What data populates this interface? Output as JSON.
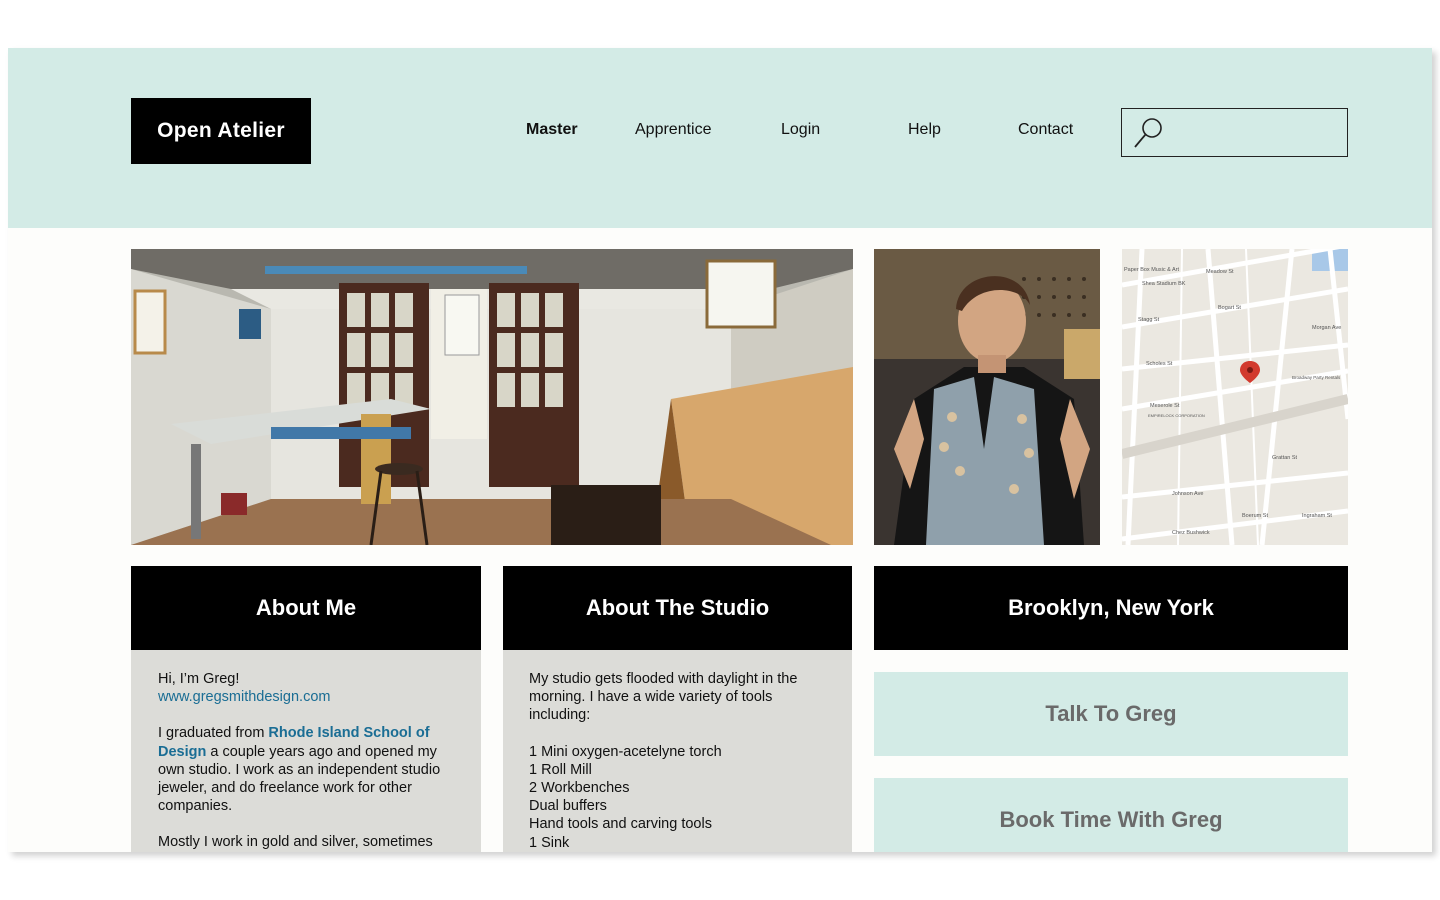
{
  "header": {
    "logo": "Open Atelier",
    "nav": [
      {
        "label": "Master",
        "active": true
      },
      {
        "label": "Apprentice",
        "active": false
      },
      {
        "label": "Login",
        "active": false
      },
      {
        "label": "Help",
        "active": false
      },
      {
        "label": "Contact",
        "active": false
      }
    ],
    "search": {
      "icon": "search-icon",
      "placeholder": ""
    }
  },
  "images": {
    "studio": "studio-interior-photo",
    "greg": "greg-portrait-photo",
    "map": "brooklyn-street-map"
  },
  "map_labels": {
    "l1": "Paper Box Music & Art",
    "l2": "Shea Stadium BK",
    "l3": "Meadow St",
    "l4": "Stagg St",
    "l5": "Scholes St",
    "l6": "Meserole St",
    "l7": "EMPIRELOCK CORPORATION",
    "l8": "Broadway Party Rentals",
    "l9": "Johnson Ave",
    "l10": "Ingraham St",
    "l11": "Bogart St",
    "l12": "Morgan Ave",
    "l13": "Grattan St",
    "l14": "Chez Bushwick",
    "l15": "Boerum St"
  },
  "about_me": {
    "title": "About Me",
    "greeting": "Hi, I’m Greg!",
    "website": "www.gregsmithdesign.com",
    "p2_a": "I graduated from ",
    "school": "Rhode Island School of Design",
    "p2_b": " a couple years ago and opened my own studio. I work as an independent studio jeweler, and do freelance work for other companies.",
    "p3": "Mostly I work in gold and silver, sometimes"
  },
  "about_studio": {
    "title": "About The Studio",
    "intro": "My studio gets flooded with daylight in the morning. I have a wide variety of tools including:",
    "tools": [
      "1 Mini oxygen-acetelyne torch",
      "1 Roll Mill",
      "2 Workbenches",
      "Dual buffers",
      "Hand tools and carving tools",
      "1 Sink"
    ]
  },
  "location": {
    "title": "Brooklyn, New York",
    "talk": "Talk To Greg",
    "book": "Book Time With Greg"
  },
  "colors": {
    "accent_mint": "#d3ebe6",
    "link_blue": "#1a6d94",
    "panel_grey": "#dcdcd8"
  }
}
